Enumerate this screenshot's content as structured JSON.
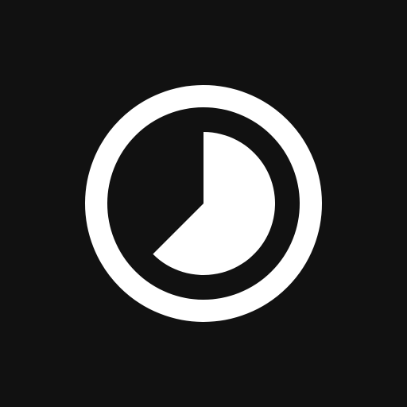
{
  "icon": {
    "name": "timer-icon",
    "elapsed_fraction": 0.625
  },
  "colors": {
    "background": "#111111",
    "foreground": "#ffffff"
  }
}
